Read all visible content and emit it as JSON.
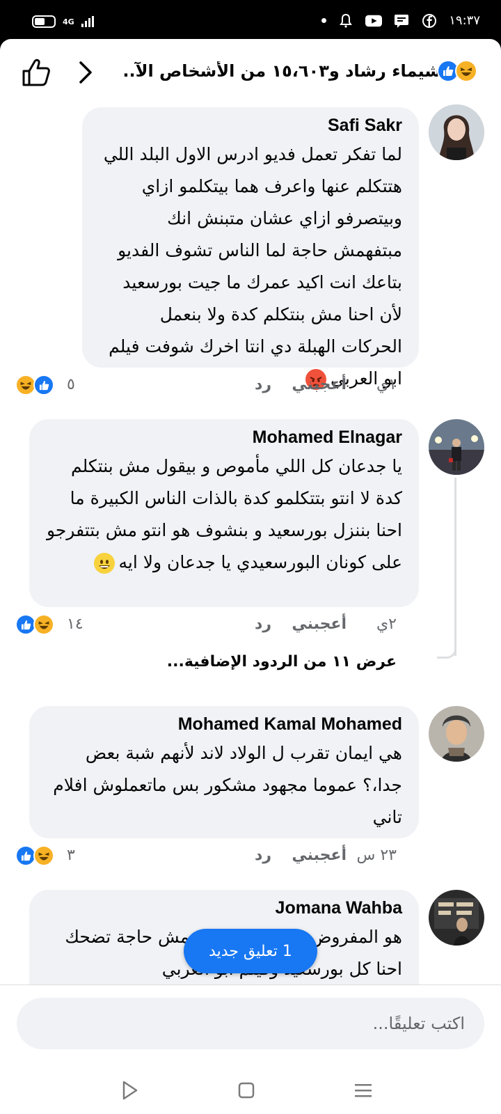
{
  "status_bar": {
    "network": "4G",
    "time": "١٩:٣٧",
    "icons": [
      "battery-icon",
      "signal-icon",
      "dot-icon",
      "notification-bell-icon",
      "youtube-icon",
      "message-icon",
      "facebook-icon"
    ]
  },
  "header": {
    "title": "شيماء رشاد و١٥،٦٠٣ من الأشخاص الآ...",
    "reactions": [
      "haha",
      "like"
    ],
    "back_icon": "chevron-right-icon",
    "like_icon": "thumbs-up-icon"
  },
  "comments": [
    {
      "name": "Safi Sakr",
      "text": "لما تفكر تعمل فديو ادرس الاول البلد اللي هتتكلم عنها واعرف هما بيتكلمو ازاي وبيتصرفو ازاي عشان متبنش انك مبتفهمش حاجة لما الناس تشوف الفديو بتاعك انت اكيد عمرك ما جيت بورسعيد لأن احنا مش بنتكلم كدة ولا بنعمل الحركات الهبلة دي انتا اخرك شوفت فيلم ابو العربي",
      "emoji": "angry-emoji",
      "time": "١ي",
      "like_label": "أعجبني",
      "reply_label": "رد",
      "reaction_count": "٥",
      "reactions": [
        "haha",
        "like"
      ]
    },
    {
      "name": "Mohamed Elnagar",
      "text": "يا جدعان كل اللي مأموص و بيقول مش بنتكلم كدة لا انتو بتتكلمو كدة بالذات الناس الكبيرة ما احنا بننزل بورسعيد و بنشوف هو انتو مش بتتفرجو على كونان البورسعيدي يا جدعان ولا ايه",
      "emoji": "grin-emoji",
      "time": "٢ي",
      "like_label": "أعجبني",
      "reply_label": "رد",
      "reaction_count": "١٤",
      "reactions": [
        "like",
        "haha"
      ]
    },
    {
      "name": "Mohamed Kamal Mohamed",
      "text": "هي ايمان تقرب ل الولاد لاند لأنهم شبة بعض جدا،؟ عموما مجهود مشكور بس ماتعملوش افلام تاني",
      "time": "٢٣ س",
      "like_label": "أعجبني",
      "reply_label": "رد",
      "reaction_count": "٣",
      "reactions": [
        "like",
        "haha"
      ]
    },
    {
      "name": "Jomana Wahba",
      "text": "هو المفروض يبقى قلبشة دي مش حاجة تضحك احنا كل بورسعيد وفيلم ابو العربي"
    }
  ],
  "more_replies": "عرض ١١ من الردود الإضافية...",
  "new_comment_pill": "1 تعليق جديد",
  "composer": {
    "placeholder": "اكتب تعليقًا..."
  },
  "nav": {
    "icons": [
      "menu-icon",
      "home-square-icon",
      "back-triangle-icon"
    ]
  },
  "colors": {
    "accent": "#1877f2",
    "bubble": "#f0f2f5",
    "secondary_text": "#65676b",
    "haha": "#f7b125"
  }
}
